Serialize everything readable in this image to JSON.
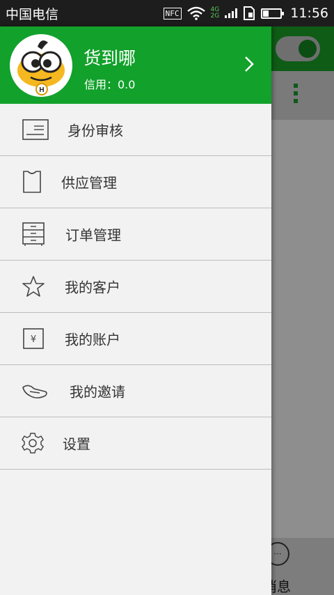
{
  "status_bar": {
    "carrier": "中国电信",
    "nfc": "NFC",
    "net_top": "4G",
    "net_bottom": "2G",
    "time": "11:56",
    "battery_level": 0.3
  },
  "drawer": {
    "user_name": "货到哪",
    "credit": "信用：0.0",
    "avatar_badge": "H",
    "menu": [
      {
        "label": "身份审核",
        "icon": "id-card-icon"
      },
      {
        "label": "供应管理",
        "icon": "clipboard-icon"
      },
      {
        "label": "订单管理",
        "icon": "cabinet-icon"
      },
      {
        "label": "我的客户",
        "icon": "star-icon"
      },
      {
        "label": "我的账户",
        "icon": "yen-wallet-icon"
      },
      {
        "label": "我的邀请",
        "icon": "hand-icon"
      },
      {
        "label": "设置",
        "icon": "gear-icon"
      }
    ]
  },
  "background": {
    "message_label": "消息",
    "chat_icon_text": "···"
  },
  "colors": {
    "primary": "#12a12b",
    "status_bar": "#1d1d1d",
    "drawer_bg": "#f2f2f2",
    "divider": "#bdbdbd"
  }
}
